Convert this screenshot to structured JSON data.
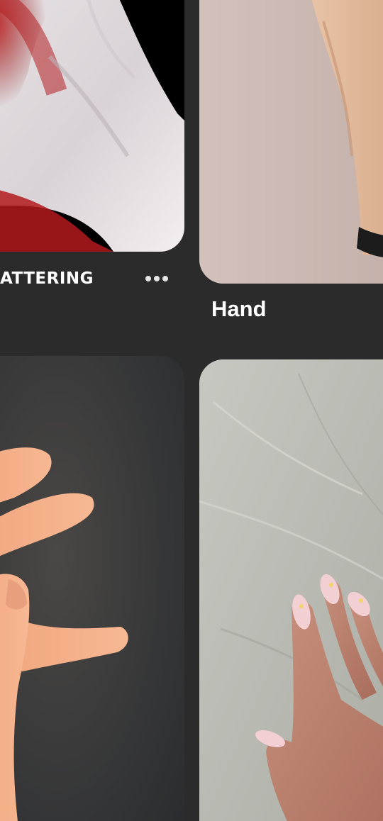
{
  "feed": {
    "pins": [
      {
        "title": "ATTERING",
        "image_icon": "photo-hand-red-light",
        "has_more_menu": true
      },
      {
        "title": "Hand",
        "image_icon": "photo-raised-hand"
      },
      {
        "title": "",
        "image_icon": "photo-fingers-dark-background"
      },
      {
        "title": "",
        "image_icon": "photo-hand-nails-linen"
      }
    ],
    "more_menu_icon": "more-horizontal-icon"
  },
  "colors": {
    "background": "#2b2b2b",
    "text": "#ffffff",
    "menu_dots": "#e6e6e6"
  }
}
